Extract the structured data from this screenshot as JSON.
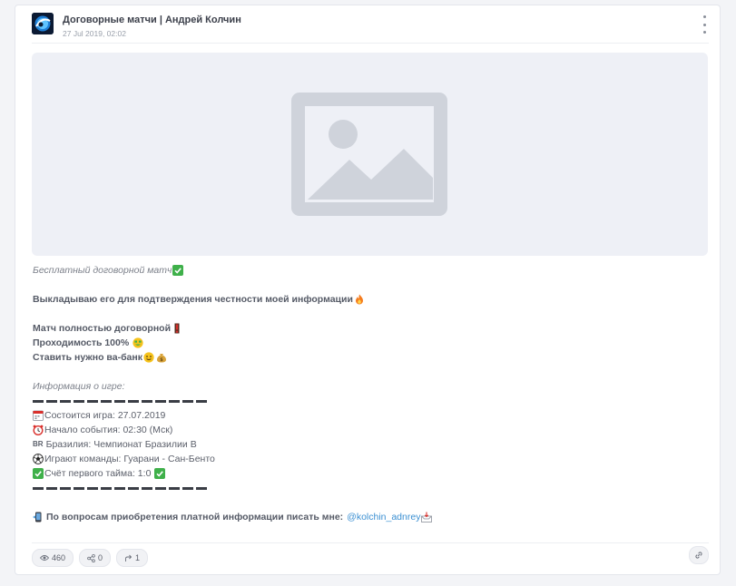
{
  "post": {
    "channel_name": "Договорные матчи | Андрей Колчин",
    "date": "27 Jul 2019, 02:02",
    "lines": {
      "l1": "Бесплатный договорной матч",
      "l2": "Выкладываю его для подтверждения честности моей информации",
      "l3": "Матч полностью договорной",
      "l4": "Проходимость 100%",
      "l5": "Ставить нужно ва-банк",
      "l6": "Информация о игре:",
      "l7": "Состоится игра: 27.07.2019",
      "l8": "Начало события: 02:30 (Мск)",
      "l9_flag": "BR",
      "l9": "Бразилия: Чемпионат Бразилии B",
      "l10": "Играют команды: Гуарани - Сан-Бенто",
      "l11": "Счёт первого тайма: 1:0",
      "l12": "По вопросам приобретения платной информации писать мне:",
      "l12_link": "@kolchin_adnrey"
    },
    "stats": {
      "views": "460",
      "shares": "0",
      "forwards": "1"
    }
  },
  "icons": {
    "views": "eye-icon",
    "shares": "share-icon",
    "forwards": "forward-icon",
    "link": "link-icon",
    "menu": "more-vertical-icon",
    "media": "image-placeholder-icon"
  },
  "colors": {
    "accent_link": "#3a8fd2",
    "check_green": "#3fb04a",
    "placeholder_bg": "#eef0f6",
    "placeholder_icon": "#cfd3db"
  }
}
